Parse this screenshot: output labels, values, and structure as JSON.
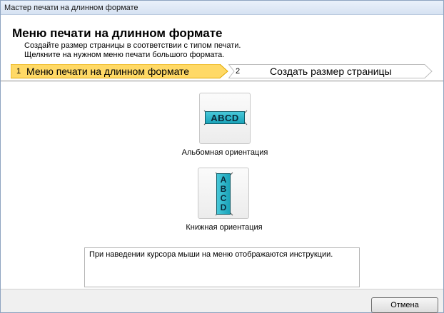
{
  "window": {
    "title": "Мастер печати на длинном формате"
  },
  "header": {
    "title": "Меню печати на длинном формате",
    "line1": "Создайте размер страницы в соответствии с типом печати.",
    "line2": "Щелкните на нужном меню печати большого формата."
  },
  "steps": [
    {
      "number": "1",
      "label": "Меню печати на длинном формате",
      "active": true
    },
    {
      "number": "2",
      "label": "Создать размер страницы",
      "active": false
    }
  ],
  "options": [
    {
      "label": "Альбомная ориентация",
      "icon": "landscape-orientation-icon",
      "icon_text": "ABCD"
    },
    {
      "label": "Книжная ориентация",
      "icon": "portrait-orientation-icon",
      "icon_text": [
        "A",
        "B",
        "C",
        "D"
      ]
    }
  ],
  "info": {
    "text": "При наведении курсора мыши на меню отображаются инструкции."
  },
  "footer": {
    "cancel_label": "Отмена"
  },
  "colors": {
    "active_step": "#ffd966",
    "accent_teal": "#1aa3b9",
    "titlebar": "#dbe6f4"
  }
}
